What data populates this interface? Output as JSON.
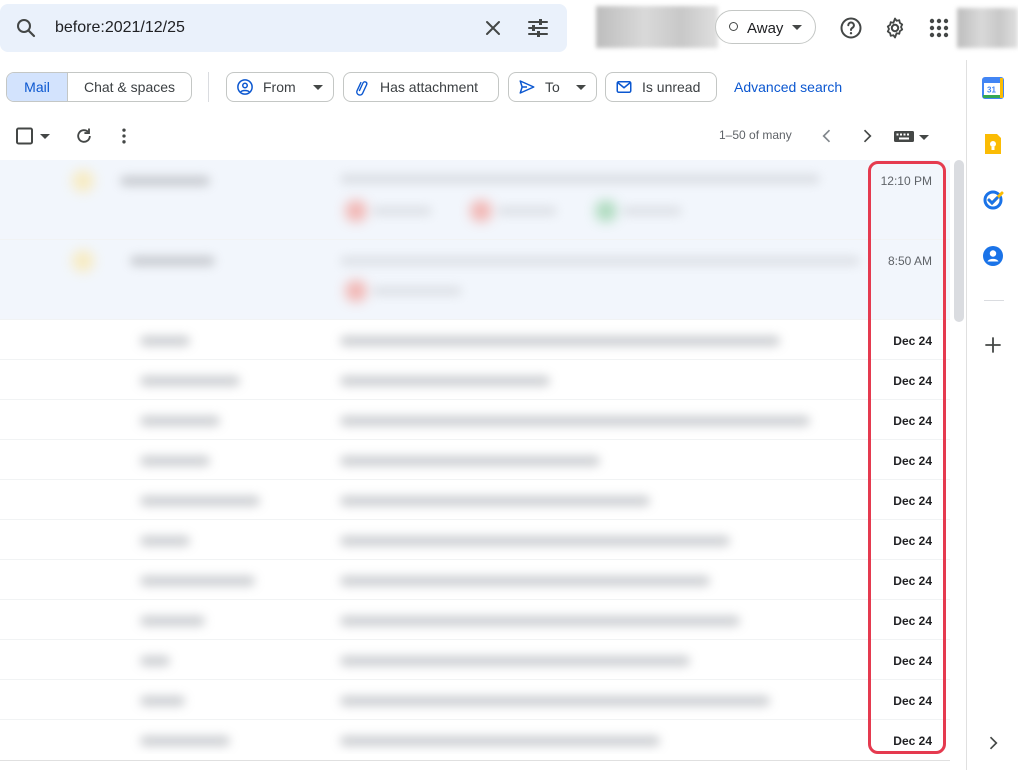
{
  "search": {
    "query": "before:2021/12/25"
  },
  "status": {
    "label": "Away"
  },
  "filters": {
    "mail_label": "Mail",
    "chat_label": "Chat & spaces",
    "from_label": "From",
    "attachment_label": "Has attachment",
    "to_label": "To",
    "unread_label": "Is unread",
    "advanced_label": "Advanced search"
  },
  "toolbar": {
    "pagination": "1–50 of many"
  },
  "emails": [
    {
      "date": "12:10 PM",
      "is_time": true
    },
    {
      "date": "8:50 AM",
      "is_time": true
    },
    {
      "date": "Dec 24"
    },
    {
      "date": "Dec 24"
    },
    {
      "date": "Dec 24"
    },
    {
      "date": "Dec 24"
    },
    {
      "date": "Dec 24"
    },
    {
      "date": "Dec 24"
    },
    {
      "date": "Dec 24"
    },
    {
      "date": "Dec 24"
    },
    {
      "date": "Dec 24"
    },
    {
      "date": "Dec 24"
    },
    {
      "date": "Dec 24"
    }
  ],
  "side_panel": {
    "calendar_day": "31"
  },
  "colors": {
    "accent_blue": "#0b57d0",
    "highlight_red": "#e53a4f",
    "keep_yellow": "#fbbc04",
    "tasks_blue": "#1a73e8",
    "contacts_blue": "#1a73e8"
  },
  "icons": [
    "search-icon",
    "close-icon",
    "tune-icon",
    "help-icon",
    "gear-icon",
    "apps-icon",
    "checkbox-icon",
    "refresh-icon",
    "more-vert-icon",
    "chevron-left-icon",
    "chevron-right-icon",
    "keyboard-icon",
    "calendar-icon",
    "keep-icon",
    "tasks-icon",
    "contacts-icon",
    "plus-icon",
    "chevron-right-icon"
  ]
}
